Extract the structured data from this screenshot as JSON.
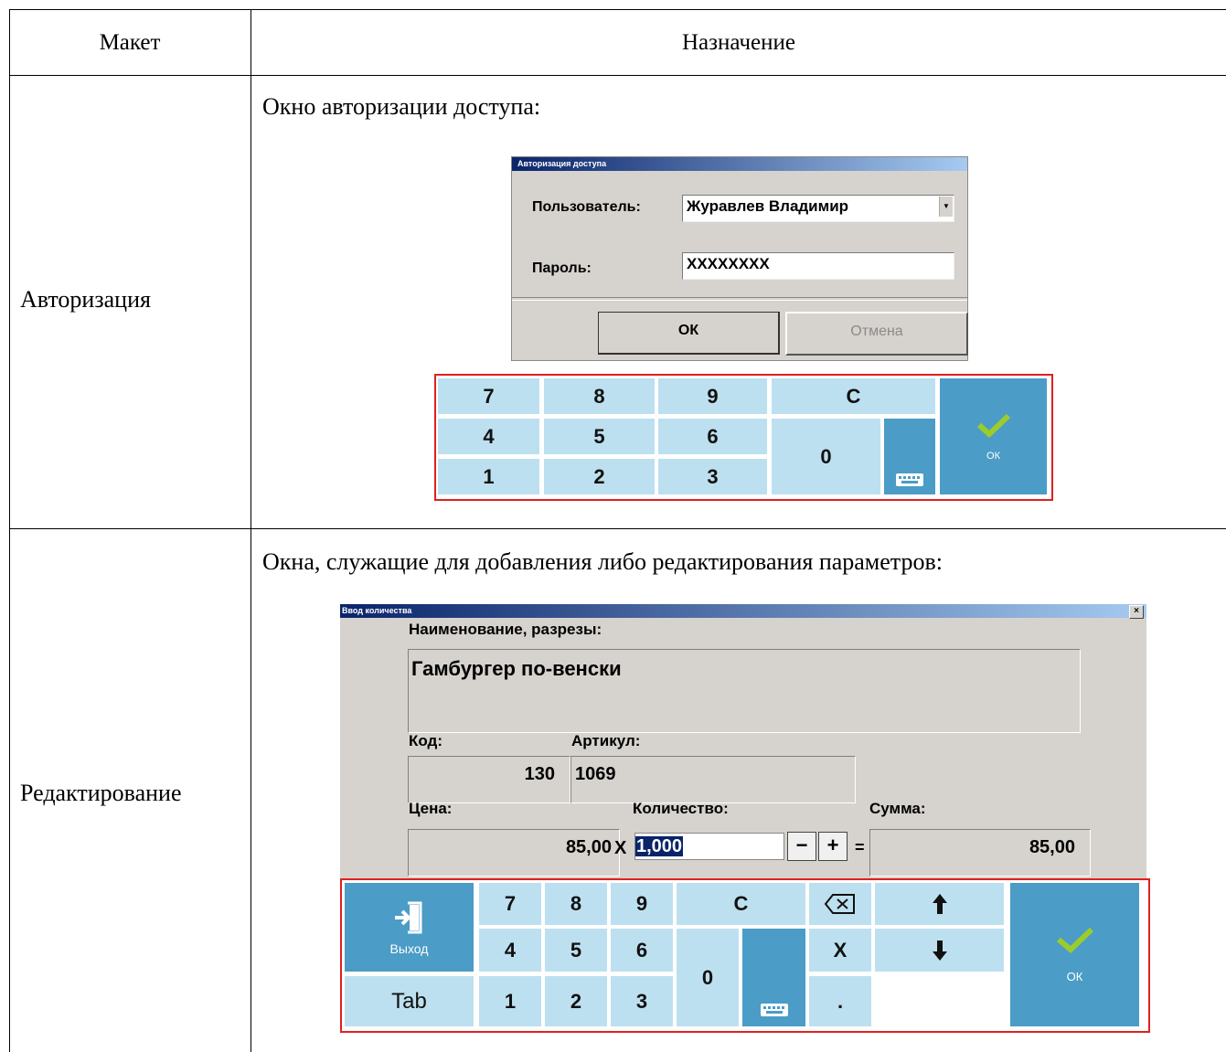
{
  "table": {
    "col_layout": "Макет",
    "col_purpose": "Назначение",
    "rows": [
      {
        "label": "Авторизация",
        "intro": "Окно авторизации доступа:",
        "dialog": {
          "title": "Авторизация доступа",
          "user_label": "Пользователь:",
          "user_value": "Журавлев Владимир",
          "password_label": "Пароль:",
          "password_value": "XXXXXXXX",
          "ok_label": "ОК",
          "cancel_label": "Отмена"
        },
        "keypad": {
          "keys": [
            "7",
            "8",
            "9",
            "C",
            "4",
            "5",
            "6",
            "0",
            "1",
            "2",
            "3"
          ],
          "ok_label": "ОК"
        }
      },
      {
        "label": "Редактирование",
        "intro": "Окна, служащие для добавления либо редактирования параметров:",
        "dialog": {
          "title": "Ввод количества",
          "close": "×",
          "name_label": "Наименование, разрезы:",
          "name_value": "Гамбургер по-венски",
          "code_label": "Код:",
          "code_value": "130",
          "article_label": "Артикул:",
          "article_value": "1069",
          "price_label": "Цена:",
          "price_value": "85,00",
          "times": "X",
          "qty_label": "Количество:",
          "qty_value": "1,000",
          "minus": "−",
          "plus": "+",
          "equals": "=",
          "sum_label": "Сумма:",
          "sum_value": "85,00"
        },
        "keypad": {
          "exit_label": "Выход",
          "tab_label": "Tab",
          "keys": [
            "7",
            "8",
            "9",
            "C",
            "4",
            "5",
            "6",
            "0",
            "1",
            "2",
            "3"
          ],
          "x_key": "X",
          "dot_key": ".",
          "ok_label": "ОК"
        }
      }
    ]
  },
  "colors": {
    "keypad_key": "#bde0f0",
    "keypad_dark": "#4b9cc6",
    "keypad_border": "#e02020",
    "check": "#9ccc2c"
  },
  "icons": [
    "checkmark-icon",
    "keyboard-icon",
    "backspace-icon",
    "arrow-up-icon",
    "arrow-down-icon",
    "exit-door-icon",
    "dropdown-arrow-icon",
    "close-icon"
  ]
}
